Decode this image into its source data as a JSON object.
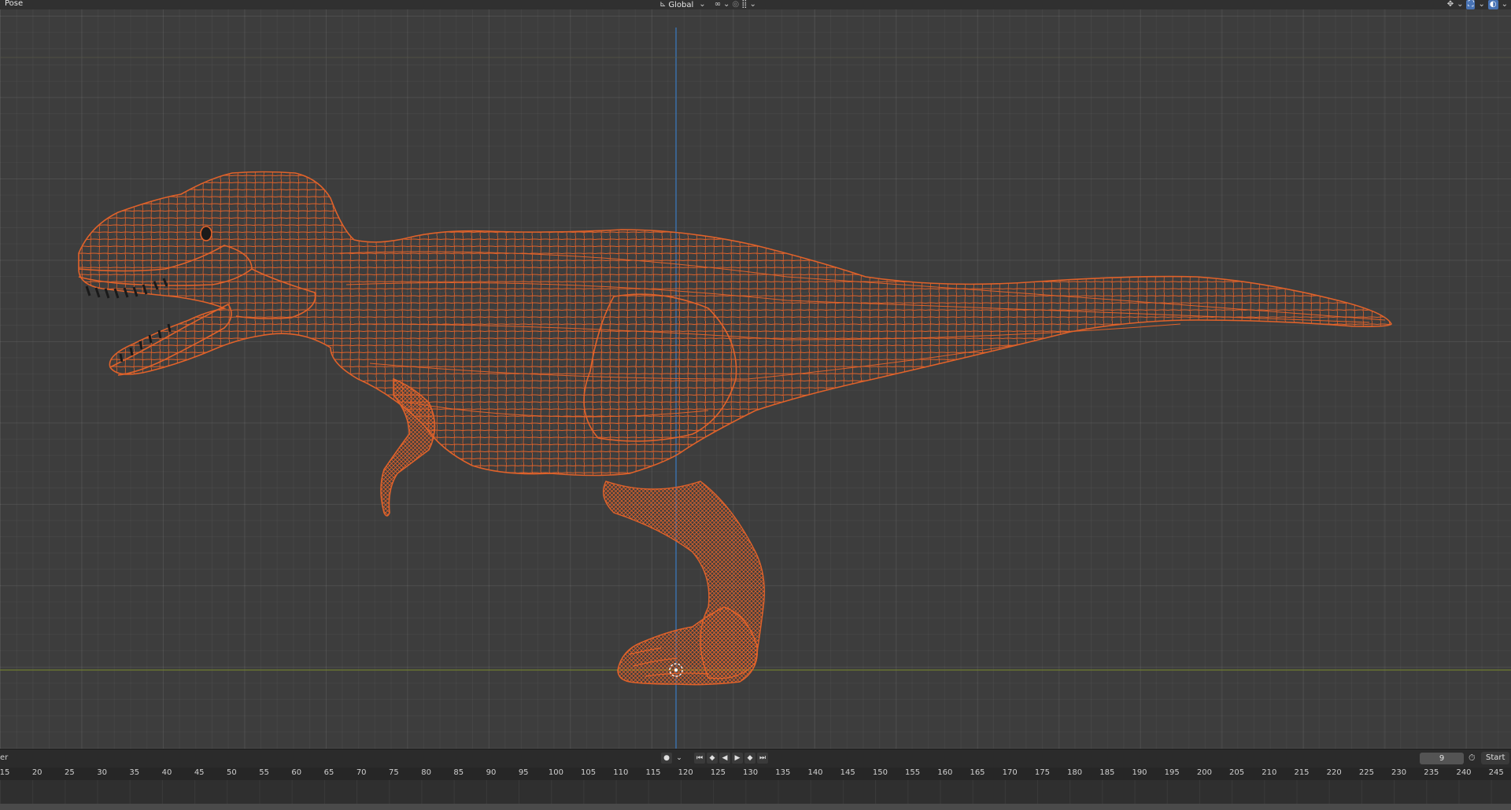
{
  "header": {
    "mode": "Pose",
    "orientation": "Global",
    "icons": [
      "transform-orientation-icon",
      "chevron-down-icon",
      "snap-link-icon",
      "proportional-editing-icon",
      "snap-grid-icon",
      "chevron-down-icon",
      "gizmo-icon",
      "chevron-down-icon",
      "overlay-icon",
      "chevron-down-icon",
      "viewport-shading-icon",
      "chevron-down-icon"
    ]
  },
  "viewport": {
    "object": "tyrannosaurus-wireframe",
    "wire_color": "#e0622a",
    "axis_y_color": "#3b6fa8",
    "axis_x_color": "#7a8a2a"
  },
  "timeline": {
    "editor_label": "er",
    "current_frame": "9",
    "start_label": "Start",
    "ruler_ticks": [
      "15",
      "20",
      "25",
      "30",
      "35",
      "40",
      "45",
      "50",
      "55",
      "60",
      "65",
      "70",
      "75",
      "80",
      "85",
      "90",
      "95",
      "100",
      "105",
      "110",
      "115",
      "120",
      "125",
      "130",
      "135",
      "140",
      "145",
      "150",
      "155",
      "160",
      "165",
      "170",
      "175",
      "180",
      "185",
      "190",
      "195",
      "200",
      "205",
      "210",
      "215",
      "220",
      "225",
      "230",
      "235",
      "240",
      "245"
    ]
  }
}
